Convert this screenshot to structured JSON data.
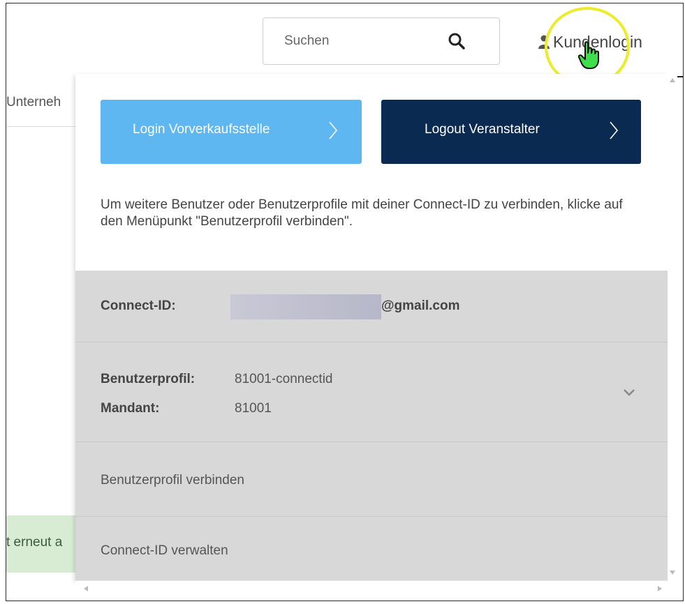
{
  "header": {
    "search_placeholder": "Suchen",
    "login_label": "Kundenlogin"
  },
  "background": {
    "partial_label": "Unterneh",
    "partial_notice": "t erneut a"
  },
  "dropdown": {
    "btn_vorverkauf": "Login Vorverkaufsstelle",
    "btn_logout": "Logout Veranstalter",
    "info_text": "Um weitere Benutzer oder Benutzerprofile mit deiner Connect-ID zu verbinden, klicke auf den Menüpunkt \"Benutzerprofil verbinden\".",
    "connect_label": "Connect-ID:",
    "connect_email": "@gmail.com",
    "profile_label": "Benutzerprofil:",
    "profile_value": "81001-connectid",
    "mandant_label": "Mandant:",
    "mandant_value": "81001",
    "link_verbinden": "Benutzerprofil verbinden",
    "link_verwalten": "Connect-ID verwalten"
  },
  "colors": {
    "button_light_blue": "#5eb7f0",
    "button_dark_navy": "#0b2a52",
    "panel_grey": "#d8d8d8",
    "highlight_yellow": "#ecec2a",
    "notice_green": "#d8ecd4"
  },
  "icons": {
    "search": "search-icon",
    "user": "user-icon",
    "cursor": "hand-cursor-icon",
    "chevron_right": "chevron-right-icon",
    "chevron_down": "chevron-down-icon"
  }
}
